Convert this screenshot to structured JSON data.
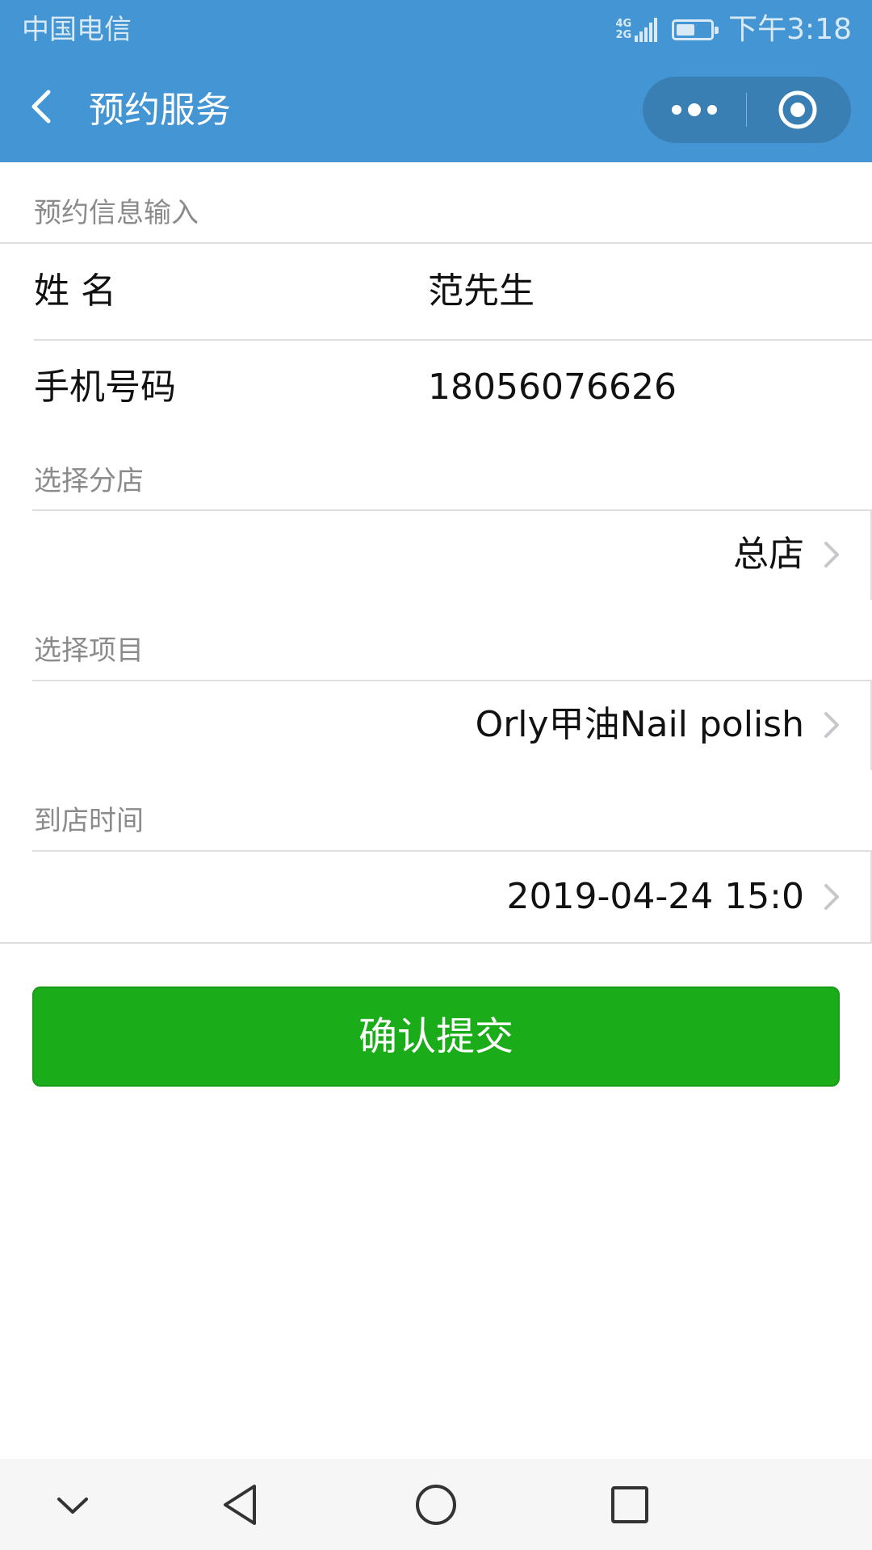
{
  "status_bar": {
    "carrier": "中国电信",
    "network_top": "4G",
    "network_bottom": "2G",
    "battery_level": 0.55,
    "time": "下午3:18"
  },
  "nav": {
    "title": "预约服务",
    "back_icon": "chevron-left-icon",
    "more_icon": "more-dots-icon",
    "close_icon": "target-close-icon"
  },
  "form": {
    "section_title": "预约信息输入",
    "name": {
      "label": "姓 名",
      "value": "范先生"
    },
    "phone": {
      "label": "手机号码",
      "value": "18056076626"
    },
    "store": {
      "label": "选择分店",
      "value": "总店"
    },
    "project": {
      "label": "选择项目",
      "value": "Orly甲油Nail polish"
    },
    "time": {
      "label": "到店时间",
      "value": "2019-04-24 15:0"
    },
    "submit_label": "确认提交"
  },
  "colors": {
    "header_bg": "#4495d3",
    "button_bg": "#1aad19",
    "label_gray": "#8b8b8b",
    "divider": "#dedede"
  },
  "system_nav": [
    "chevron-down-icon",
    "triangle-back-icon",
    "circle-home-icon",
    "square-recents-icon"
  ]
}
